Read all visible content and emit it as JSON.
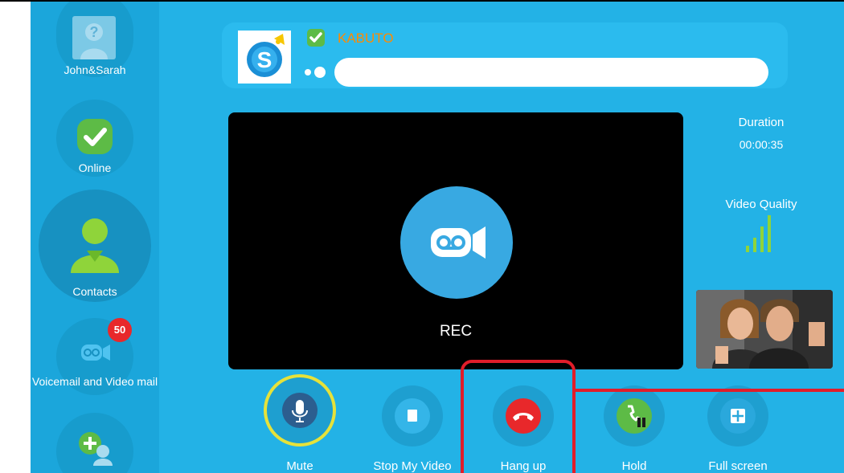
{
  "sidebar": {
    "items": [
      {
        "label": "John&Sarah",
        "icon": "unknown-person-icon"
      },
      {
        "label": "Online",
        "icon": "online-check-icon"
      },
      {
        "label": "Contacts",
        "icon": "contacts-person-icon"
      },
      {
        "label": "Voicemail and Video mail",
        "icon": "voicemail-icon",
        "badge": "50"
      },
      {
        "label": "",
        "icon": "add-contact-icon"
      }
    ]
  },
  "caller": {
    "name": "KABUTO",
    "status": "online",
    "message_placeholder": "",
    "logo_icon": "skype-logo-icon"
  },
  "video": {
    "rec_label": "REC"
  },
  "call_info": {
    "duration_label": "Duration",
    "duration_value": "00:00:35",
    "quality_label": "Video Quality"
  },
  "controls": [
    {
      "label": "Mute",
      "icon": "microphone-icon"
    },
    {
      "label": "Stop My Video",
      "icon": "stop-icon"
    },
    {
      "label": "Hang up",
      "icon": "hang-up-phone-icon"
    },
    {
      "label": "Hold",
      "icon": "hold-phone-icon"
    },
    {
      "label": "Full screen",
      "icon": "full-screen-icon"
    }
  ],
  "colors": {
    "background": "#23b2e6",
    "sidebar": "#1ba6db",
    "hangup": "#e8282b",
    "highlight": "#e11d2a",
    "caller_name": "#ff8a00",
    "mute_ring": "#e6e23a",
    "quality_bars": "#8fd43a"
  }
}
